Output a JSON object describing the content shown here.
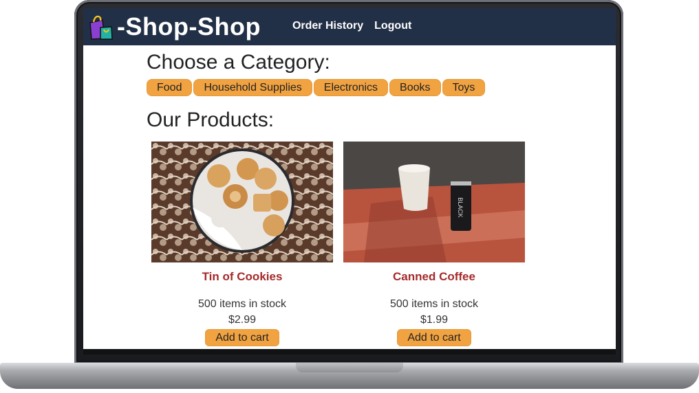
{
  "app": {
    "brand": "-Shop-Shop",
    "nav": {
      "order_history": "Order History",
      "logout": "Logout"
    }
  },
  "categories": {
    "heading": "Choose a Category:",
    "items": [
      "Food",
      "Household Supplies",
      "Electronics",
      "Books",
      "Toys"
    ]
  },
  "products": {
    "heading": "Our Products:",
    "items": [
      {
        "name": "Tin of Cookies",
        "stock": "500 items in stock",
        "price": "$2.99",
        "button": "Add to cart"
      },
      {
        "name": "Canned Coffee",
        "stock": "500 items in stock",
        "price": "$1.99",
        "button": "Add to cart"
      }
    ]
  },
  "colors": {
    "header_bg": "#223047",
    "accent": "#f1a342",
    "product_name": "#a52a2a"
  },
  "icons": [
    "shopping-bags-icon"
  ]
}
